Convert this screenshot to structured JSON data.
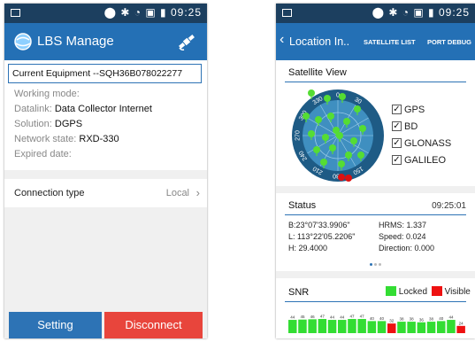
{
  "left_screen": {
    "status_bar": {
      "time": "09:25",
      "icons": [
        "gps-pin-icon",
        "bluetooth-icon",
        "wifi-icon",
        "sim-icon",
        "battery-icon"
      ]
    },
    "app_bar": {
      "title": "LBS Manage",
      "logo_icon": "lbs-logo-icon",
      "action_icon": "satellite-icon"
    },
    "equipment": {
      "current_label": "Current Equipment --SQH36B078022277",
      "fields": [
        {
          "label": "Working mode:",
          "value": ""
        },
        {
          "label": "Datalink:",
          "value": "Data Collector Internet"
        },
        {
          "label": "Solution:",
          "value": "DGPS"
        },
        {
          "label": "Network state:",
          "value": "RXD-330"
        },
        {
          "label": "Expired date:",
          "value": ""
        }
      ]
    },
    "connection": {
      "label": "Connection type",
      "value": "Local"
    },
    "buttons": {
      "setting": "Setting",
      "disconnect": "Disconnect"
    },
    "colors": {
      "status_bar": "#1c3f5f",
      "app_bar": "#2470b5",
      "setting_button": "#2d73b5",
      "disconnect_button": "#e8453c"
    }
  },
  "right_screen": {
    "status_bar": {
      "time": "09:25"
    },
    "app_bar": {
      "title": "Location In..",
      "tabs": [
        "SATELLITE LIST",
        "PORT DEBUG"
      ]
    },
    "satellite_view": {
      "title": "Satellite View",
      "compass_labels": [
        "30",
        "0",
        "330",
        "300",
        "270",
        "240",
        "210",
        "180",
        "150"
      ],
      "systems": [
        {
          "name": "GPS",
          "checked": true
        },
        {
          "name": "BD",
          "checked": true
        },
        {
          "name": "GLONASS",
          "checked": true
        },
        {
          "name": "GALILEO",
          "checked": true
        }
      ]
    },
    "status": {
      "title": "Status",
      "time": "09:25:01",
      "rows": [
        {
          "left": "B:23°07'33.9906\"",
          "right": "HRMS: 1.337"
        },
        {
          "left": "L: 113°22'05.2206\"",
          "right": "Speed: 0.024"
        },
        {
          "left": "H: 29.4000",
          "right": "Direction: 0.000"
        }
      ]
    },
    "snr": {
      "title": "SNR",
      "legend": [
        {
          "label": "Locked",
          "color": "#33dd33"
        },
        {
          "label": "Visible",
          "color": "#ee1111"
        }
      ],
      "values": [
        44,
        45,
        46,
        47,
        44,
        44,
        47,
        47,
        40,
        40,
        32,
        38,
        38,
        36,
        38,
        40,
        44,
        24
      ],
      "states": [
        "locked",
        "locked",
        "locked",
        "locked",
        "locked",
        "locked",
        "locked",
        "locked",
        "locked",
        "locked",
        "visible",
        "locked",
        "locked",
        "locked",
        "locked",
        "locked",
        "locked",
        "visible"
      ]
    },
    "colors": {
      "app_bar": "#2470b5"
    }
  }
}
